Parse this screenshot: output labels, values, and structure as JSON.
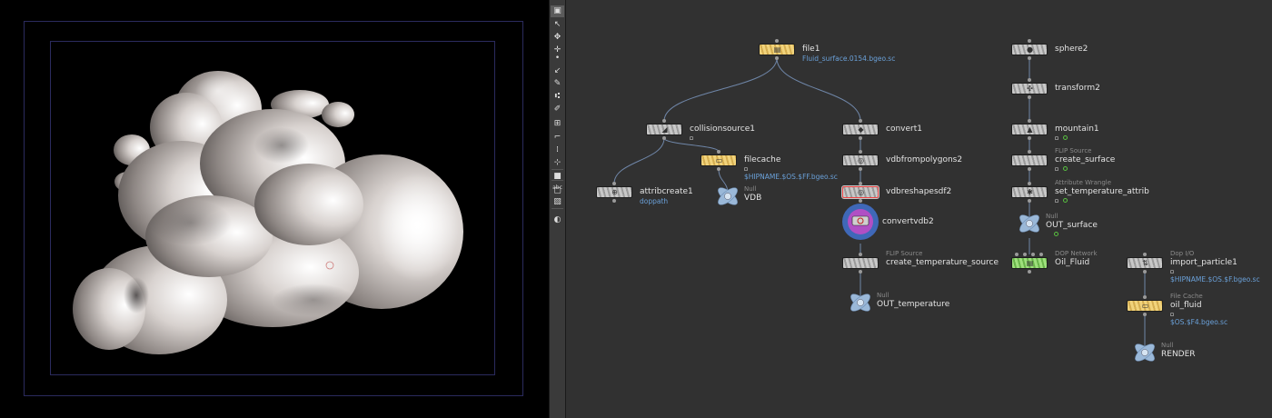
{
  "toolbar": {
    "tools": [
      {
        "icon": "select-tool-icon",
        "glyph": "▣",
        "active": true
      },
      {
        "icon": "pose-tool-icon",
        "glyph": "↖"
      },
      {
        "icon": "view-tool-icon",
        "glyph": "✥"
      },
      {
        "icon": "handle-tool-icon",
        "glyph": "✛"
      },
      {
        "icon": "point-icon",
        "glyph": "•"
      },
      {
        "icon": "edge-icon",
        "glyph": "↙"
      },
      {
        "icon": "pencil-icon",
        "glyph": "✎"
      },
      {
        "icon": "group-icon",
        "glyph": "⑆"
      },
      {
        "icon": "paint-icon",
        "glyph": "✐"
      },
      {
        "icon": "grid-icon",
        "glyph": "⊞"
      },
      {
        "icon": "ruler-icon",
        "glyph": "⌐"
      },
      {
        "icon": "snap-icon",
        "glyph": "⁞"
      },
      {
        "icon": "move-icon",
        "glyph": "⊹"
      },
      {
        "icon": "cube-icon",
        "glyph": "■"
      },
      {
        "icon": "display-icon",
        "glyph": "▢"
      },
      {
        "label": "abc",
        "icon": "text-tool-icon",
        "glyph": ""
      },
      {
        "icon": "image-icon",
        "glyph": "▧"
      },
      {
        "icon": "camera-lock-icon",
        "glyph": "◐"
      }
    ]
  },
  "viewport": {
    "background": "#000000"
  },
  "network": {
    "nodes": [
      {
        "id": "file1",
        "name": "file1",
        "color": "yellow",
        "icon": "file-icon",
        "glyph": "▤",
        "param": "Fluid_surface.0154.bgeo.sc"
      },
      {
        "id": "collisionsource1",
        "name": "collisionsource1",
        "icon": "collision-icon",
        "glyph": "◢",
        "lock": true
      },
      {
        "id": "filecache",
        "name": "filecache",
        "color": "yellow",
        "icon": "filecache-icon",
        "glyph": "▭",
        "lock": true,
        "param": "$HIPNAME.$OS.$FF.bgeo.sc"
      },
      {
        "id": "attribcreate1",
        "name": "attribcreate1",
        "icon": "attrib-icon",
        "glyph": "⊕",
        "param": "doppath"
      },
      {
        "id": "vdb",
        "name": "VDB",
        "type": "Null",
        "node": "null"
      },
      {
        "id": "convert1",
        "name": "convert1",
        "icon": "convert-icon",
        "glyph": "◆"
      },
      {
        "id": "vdbfrompolygons2",
        "name": "vdbfrompolygons2",
        "icon": "vdb-icon",
        "glyph": "◎"
      },
      {
        "id": "vdbreshapesdf2",
        "name": "vdbreshapesdf2",
        "icon": "vdb-icon",
        "glyph": "◎",
        "selected": true
      },
      {
        "id": "convertvdb2",
        "name": "convertvdb2",
        "node": "disc"
      },
      {
        "id": "create_temperature_source",
        "name": "create_temperature_source",
        "type": "FLIP Source"
      },
      {
        "id": "out_temperature",
        "name": "OUT_temperature",
        "type": "Null",
        "node": "null"
      },
      {
        "id": "sphere2",
        "name": "sphere2",
        "icon": "sphere-icon",
        "glyph": "●"
      },
      {
        "id": "transform2",
        "name": "transform2",
        "icon": "transform-icon",
        "glyph": "✣"
      },
      {
        "id": "mountain1",
        "name": "mountain1",
        "icon": "mountain-icon",
        "glyph": "▲",
        "lock": true,
        "flag": true
      },
      {
        "id": "create_surface",
        "name": "create_surface",
        "type": "FLIP Source",
        "lock": true,
        "flag": true
      },
      {
        "id": "set_temperature_attrib",
        "name": "set_temperature_attrib",
        "type": "Attribute Wrangle",
        "icon": "wrangle-icon",
        "glyph": "✱",
        "lock": true,
        "flag": true
      },
      {
        "id": "out_surface",
        "name": "OUT_surface",
        "type": "Null",
        "node": "null",
        "flag": true
      },
      {
        "id": "oil_fluid",
        "name": "Oil_Fluid",
        "type": "DOP Network",
        "color": "green",
        "icon": "dop-icon",
        "glyph": "▤"
      },
      {
        "id": "import_particle1",
        "name": "import_particle1",
        "type": "Dop I/O",
        "icon": "dopio-icon",
        "glyph": "⇅",
        "lock": true,
        "param": "$HIPNAME.$OS.$F.bgeo.sc"
      },
      {
        "id": "oil_fluid_cache",
        "name": "oil_fluid",
        "type": "File Cache",
        "color": "yellow",
        "icon": "filecache-icon",
        "glyph": "▭",
        "lock": true,
        "param": "$OS.$F4.bgeo.sc"
      },
      {
        "id": "render",
        "name": "RENDER",
        "type": "Null",
        "node": "null"
      }
    ],
    "wires": [
      [
        "file1",
        "collisionsource1"
      ],
      [
        "file1",
        "convert1"
      ],
      [
        "collisionsource1",
        "attribcreate1"
      ],
      [
        "collisionsource1",
        "filecache"
      ],
      [
        "filecache",
        "vdb"
      ],
      [
        "convert1",
        "vdbfrompolygons2"
      ],
      [
        "vdbfrompolygons2",
        "vdbreshapesdf2"
      ],
      [
        "vdbreshapesdf2",
        "convertvdb2"
      ],
      [
        "convertvdb2",
        "create_temperature_source"
      ],
      [
        "create_temperature_source",
        "out_temperature"
      ],
      [
        "sphere2",
        "transform2"
      ],
      [
        "transform2",
        "mountain1"
      ],
      [
        "mountain1",
        "create_surface"
      ],
      [
        "create_surface",
        "set_temperature_attrib"
      ],
      [
        "set_temperature_attrib",
        "out_surface"
      ],
      [
        "out_surface",
        "oil_fluid"
      ],
      [
        "import_particle1",
        "oil_fluid_cache"
      ],
      [
        "oil_fluid_cache",
        "render"
      ]
    ]
  }
}
